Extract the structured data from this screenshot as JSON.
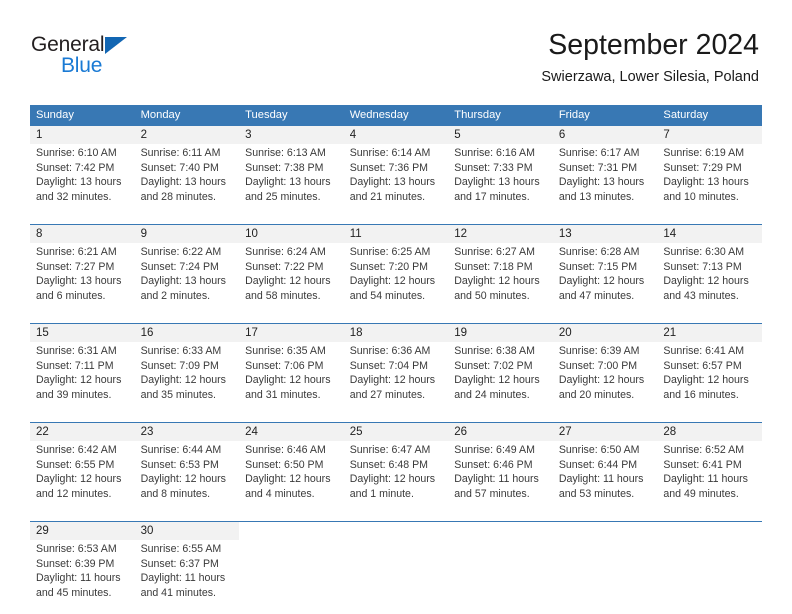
{
  "brand": {
    "name_top": "General",
    "name_bottom": "Blue",
    "accent_color": "#1a7ad4",
    "triangle_color": "#1266b3"
  },
  "header": {
    "title": "September 2024",
    "location": "Swierzawa, Lower Silesia, Poland",
    "header_bg_color": "#3878b4",
    "daynum_bg_color": "#f2f2f2"
  },
  "weekdays": [
    "Sunday",
    "Monday",
    "Tuesday",
    "Wednesday",
    "Thursday",
    "Friday",
    "Saturday"
  ],
  "weeks": [
    {
      "days": [
        {
          "num": "1",
          "sunrise": "Sunrise: 6:10 AM",
          "sunset": "Sunset: 7:42 PM",
          "daylight1": "Daylight: 13 hours",
          "daylight2": "and 32 minutes."
        },
        {
          "num": "2",
          "sunrise": "Sunrise: 6:11 AM",
          "sunset": "Sunset: 7:40 PM",
          "daylight1": "Daylight: 13 hours",
          "daylight2": "and 28 minutes."
        },
        {
          "num": "3",
          "sunrise": "Sunrise: 6:13 AM",
          "sunset": "Sunset: 7:38 PM",
          "daylight1": "Daylight: 13 hours",
          "daylight2": "and 25 minutes."
        },
        {
          "num": "4",
          "sunrise": "Sunrise: 6:14 AM",
          "sunset": "Sunset: 7:36 PM",
          "daylight1": "Daylight: 13 hours",
          "daylight2": "and 21 minutes."
        },
        {
          "num": "5",
          "sunrise": "Sunrise: 6:16 AM",
          "sunset": "Sunset: 7:33 PM",
          "daylight1": "Daylight: 13 hours",
          "daylight2": "and 17 minutes."
        },
        {
          "num": "6",
          "sunrise": "Sunrise: 6:17 AM",
          "sunset": "Sunset: 7:31 PM",
          "daylight1": "Daylight: 13 hours",
          "daylight2": "and 13 minutes."
        },
        {
          "num": "7",
          "sunrise": "Sunrise: 6:19 AM",
          "sunset": "Sunset: 7:29 PM",
          "daylight1": "Daylight: 13 hours",
          "daylight2": "and 10 minutes."
        }
      ]
    },
    {
      "days": [
        {
          "num": "8",
          "sunrise": "Sunrise: 6:21 AM",
          "sunset": "Sunset: 7:27 PM",
          "daylight1": "Daylight: 13 hours",
          "daylight2": "and 6 minutes."
        },
        {
          "num": "9",
          "sunrise": "Sunrise: 6:22 AM",
          "sunset": "Sunset: 7:24 PM",
          "daylight1": "Daylight: 13 hours",
          "daylight2": "and 2 minutes."
        },
        {
          "num": "10",
          "sunrise": "Sunrise: 6:24 AM",
          "sunset": "Sunset: 7:22 PM",
          "daylight1": "Daylight: 12 hours",
          "daylight2": "and 58 minutes."
        },
        {
          "num": "11",
          "sunrise": "Sunrise: 6:25 AM",
          "sunset": "Sunset: 7:20 PM",
          "daylight1": "Daylight: 12 hours",
          "daylight2": "and 54 minutes."
        },
        {
          "num": "12",
          "sunrise": "Sunrise: 6:27 AM",
          "sunset": "Sunset: 7:18 PM",
          "daylight1": "Daylight: 12 hours",
          "daylight2": "and 50 minutes."
        },
        {
          "num": "13",
          "sunrise": "Sunrise: 6:28 AM",
          "sunset": "Sunset: 7:15 PM",
          "daylight1": "Daylight: 12 hours",
          "daylight2": "and 47 minutes."
        },
        {
          "num": "14",
          "sunrise": "Sunrise: 6:30 AM",
          "sunset": "Sunset: 7:13 PM",
          "daylight1": "Daylight: 12 hours",
          "daylight2": "and 43 minutes."
        }
      ]
    },
    {
      "days": [
        {
          "num": "15",
          "sunrise": "Sunrise: 6:31 AM",
          "sunset": "Sunset: 7:11 PM",
          "daylight1": "Daylight: 12 hours",
          "daylight2": "and 39 minutes."
        },
        {
          "num": "16",
          "sunrise": "Sunrise: 6:33 AM",
          "sunset": "Sunset: 7:09 PM",
          "daylight1": "Daylight: 12 hours",
          "daylight2": "and 35 minutes."
        },
        {
          "num": "17",
          "sunrise": "Sunrise: 6:35 AM",
          "sunset": "Sunset: 7:06 PM",
          "daylight1": "Daylight: 12 hours",
          "daylight2": "and 31 minutes."
        },
        {
          "num": "18",
          "sunrise": "Sunrise: 6:36 AM",
          "sunset": "Sunset: 7:04 PM",
          "daylight1": "Daylight: 12 hours",
          "daylight2": "and 27 minutes."
        },
        {
          "num": "19",
          "sunrise": "Sunrise: 6:38 AM",
          "sunset": "Sunset: 7:02 PM",
          "daylight1": "Daylight: 12 hours",
          "daylight2": "and 24 minutes."
        },
        {
          "num": "20",
          "sunrise": "Sunrise: 6:39 AM",
          "sunset": "Sunset: 7:00 PM",
          "daylight1": "Daylight: 12 hours",
          "daylight2": "and 20 minutes."
        },
        {
          "num": "21",
          "sunrise": "Sunrise: 6:41 AM",
          "sunset": "Sunset: 6:57 PM",
          "daylight1": "Daylight: 12 hours",
          "daylight2": "and 16 minutes."
        }
      ]
    },
    {
      "days": [
        {
          "num": "22",
          "sunrise": "Sunrise: 6:42 AM",
          "sunset": "Sunset: 6:55 PM",
          "daylight1": "Daylight: 12 hours",
          "daylight2": "and 12 minutes."
        },
        {
          "num": "23",
          "sunrise": "Sunrise: 6:44 AM",
          "sunset": "Sunset: 6:53 PM",
          "daylight1": "Daylight: 12 hours",
          "daylight2": "and 8 minutes."
        },
        {
          "num": "24",
          "sunrise": "Sunrise: 6:46 AM",
          "sunset": "Sunset: 6:50 PM",
          "daylight1": "Daylight: 12 hours",
          "daylight2": "and 4 minutes."
        },
        {
          "num": "25",
          "sunrise": "Sunrise: 6:47 AM",
          "sunset": "Sunset: 6:48 PM",
          "daylight1": "Daylight: 12 hours",
          "daylight2": "and 1 minute."
        },
        {
          "num": "26",
          "sunrise": "Sunrise: 6:49 AM",
          "sunset": "Sunset: 6:46 PM",
          "daylight1": "Daylight: 11 hours",
          "daylight2": "and 57 minutes."
        },
        {
          "num": "27",
          "sunrise": "Sunrise: 6:50 AM",
          "sunset": "Sunset: 6:44 PM",
          "daylight1": "Daylight: 11 hours",
          "daylight2": "and 53 minutes."
        },
        {
          "num": "28",
          "sunrise": "Sunrise: 6:52 AM",
          "sunset": "Sunset: 6:41 PM",
          "daylight1": "Daylight: 11 hours",
          "daylight2": "and 49 minutes."
        }
      ]
    },
    {
      "days": [
        {
          "num": "29",
          "sunrise": "Sunrise: 6:53 AM",
          "sunset": "Sunset: 6:39 PM",
          "daylight1": "Daylight: 11 hours",
          "daylight2": "and 45 minutes."
        },
        {
          "num": "30",
          "sunrise": "Sunrise: 6:55 AM",
          "sunset": "Sunset: 6:37 PM",
          "daylight1": "Daylight: 11 hours",
          "daylight2": "and 41 minutes."
        },
        {
          "num": "",
          "sunrise": "",
          "sunset": "",
          "daylight1": "",
          "daylight2": ""
        },
        {
          "num": "",
          "sunrise": "",
          "sunset": "",
          "daylight1": "",
          "daylight2": ""
        },
        {
          "num": "",
          "sunrise": "",
          "sunset": "",
          "daylight1": "",
          "daylight2": ""
        },
        {
          "num": "",
          "sunrise": "",
          "sunset": "",
          "daylight1": "",
          "daylight2": ""
        },
        {
          "num": "",
          "sunrise": "",
          "sunset": "",
          "daylight1": "",
          "daylight2": ""
        }
      ]
    }
  ]
}
